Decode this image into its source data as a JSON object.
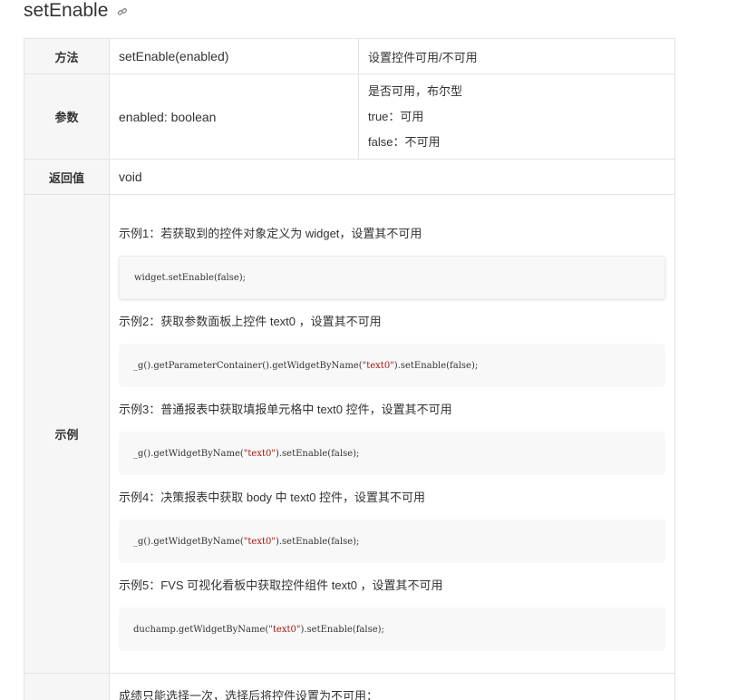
{
  "heading": {
    "title": "setEnable",
    "anchor_icon": "link-icon"
  },
  "table": {
    "method": {
      "label": "方法",
      "signature": "setEnable(enabled)",
      "description": "设置控件可用/不可用"
    },
    "params": {
      "label": "参数",
      "name": "enabled: boolean",
      "lines": [
        "是否可用，布尔型",
        "true：可用",
        "false：不可用"
      ]
    },
    "returns": {
      "label": "返回值",
      "value": "void"
    },
    "examples": {
      "label": "示例",
      "items": [
        {
          "title": "示例1：若获取到的控件对象定义为 widget，设置其不可用",
          "code_pre": "widget.setEnable(false);",
          "code_str": "",
          "code_post": ""
        },
        {
          "title": "示例2：获取参数面板上控件 text0 ，设置其不可用",
          "code_pre": "_g().getParameterContainer().getWidgetByName(",
          "code_str": "\"text0\"",
          "code_post": ").setEnable(false);"
        },
        {
          "title": "示例3：普通报表中获取填报单元格中 text0 控件，设置其不可用",
          "code_pre": "_g().getWidgetByName(",
          "code_str": "\"text0\"",
          "code_post": ").setEnable(false);"
        },
        {
          "title": "示例4：决策报表中获取 body 中 text0 控件，设置其不可用",
          "code_pre": "_g().getWidgetByName(",
          "code_str": "\"text0\"",
          "code_post": ").setEnable(false);"
        },
        {
          "title": "示例5：FVS 可视化看板中获取控件组件 text0 ，设置其不可用",
          "code_pre": "duchamp.getWidgetByName(",
          "code_str": "\"text0\"",
          "code_post": ").setEnable(false);"
        }
      ]
    },
    "next_row": {
      "label": "",
      "text": "成绩只能选择一次，选择后将控件设置为不可用："
    }
  }
}
